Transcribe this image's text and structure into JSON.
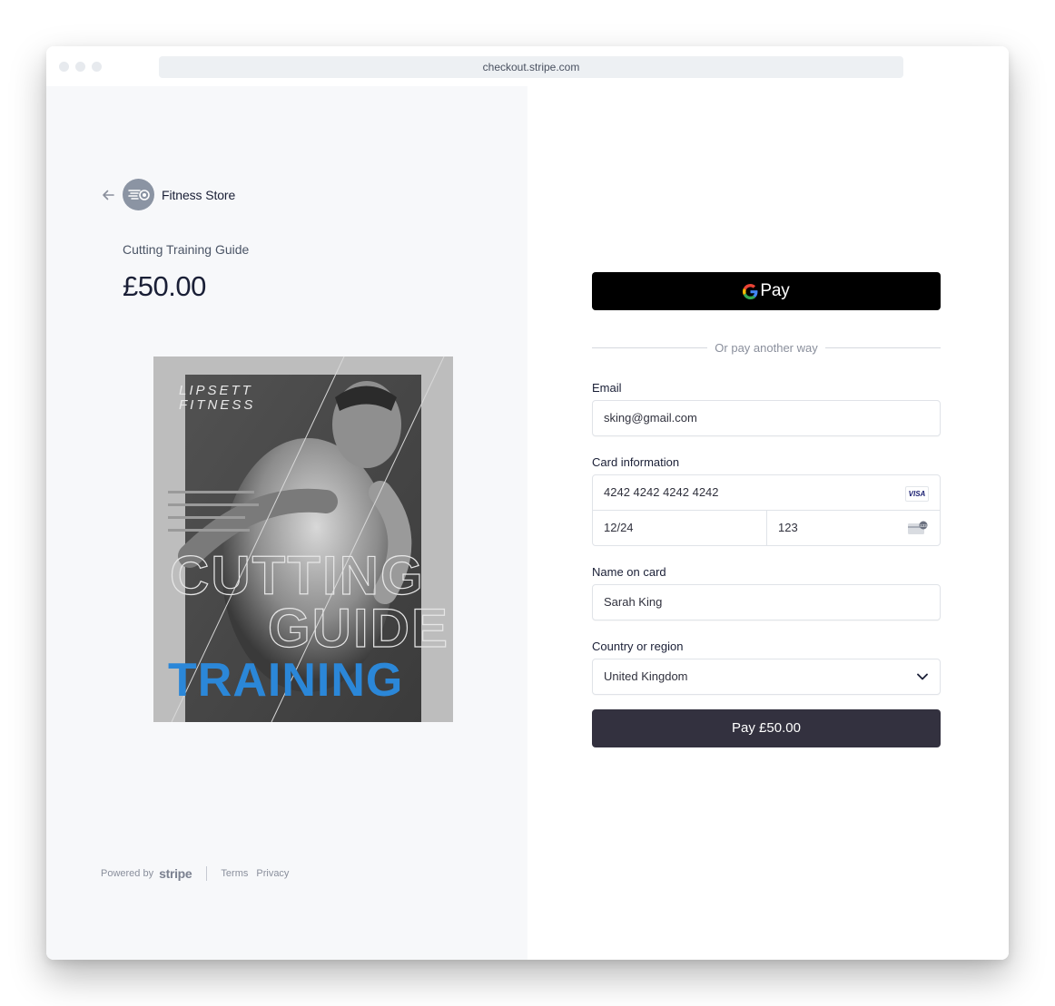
{
  "browser": {
    "url": "checkout.stripe.com"
  },
  "merchant": {
    "name": "Fitness Store"
  },
  "product": {
    "name": "Cutting Training Guide",
    "price": "£50.00",
    "image": {
      "brand_line1": "LIPSETT",
      "brand_line2": "FITNESS",
      "title_line1": "CUTTING",
      "title_line2": "GUIDE",
      "title_line3": "TRAINING",
      "accent": "#2b87d8"
    }
  },
  "footer": {
    "powered_by": "Powered by",
    "brand": "stripe",
    "terms": "Terms",
    "privacy": "Privacy"
  },
  "payment": {
    "gpay_label": "Pay",
    "divider_text": "Or pay another way",
    "email": {
      "label": "Email",
      "value": "sking@gmail.com"
    },
    "card": {
      "label": "Card information",
      "number": "4242 4242 4242 4242",
      "brand": "VISA",
      "expiry": "12/24",
      "cvc": "123"
    },
    "name": {
      "label": "Name on card",
      "value": "Sarah King"
    },
    "country": {
      "label": "Country or region",
      "value": "United Kingdom"
    },
    "pay_button": "Pay £50.00"
  },
  "colors": {
    "pay_button": "#33313f",
    "gpay_button": "#000000",
    "left_panel": "#f7f8fa"
  }
}
